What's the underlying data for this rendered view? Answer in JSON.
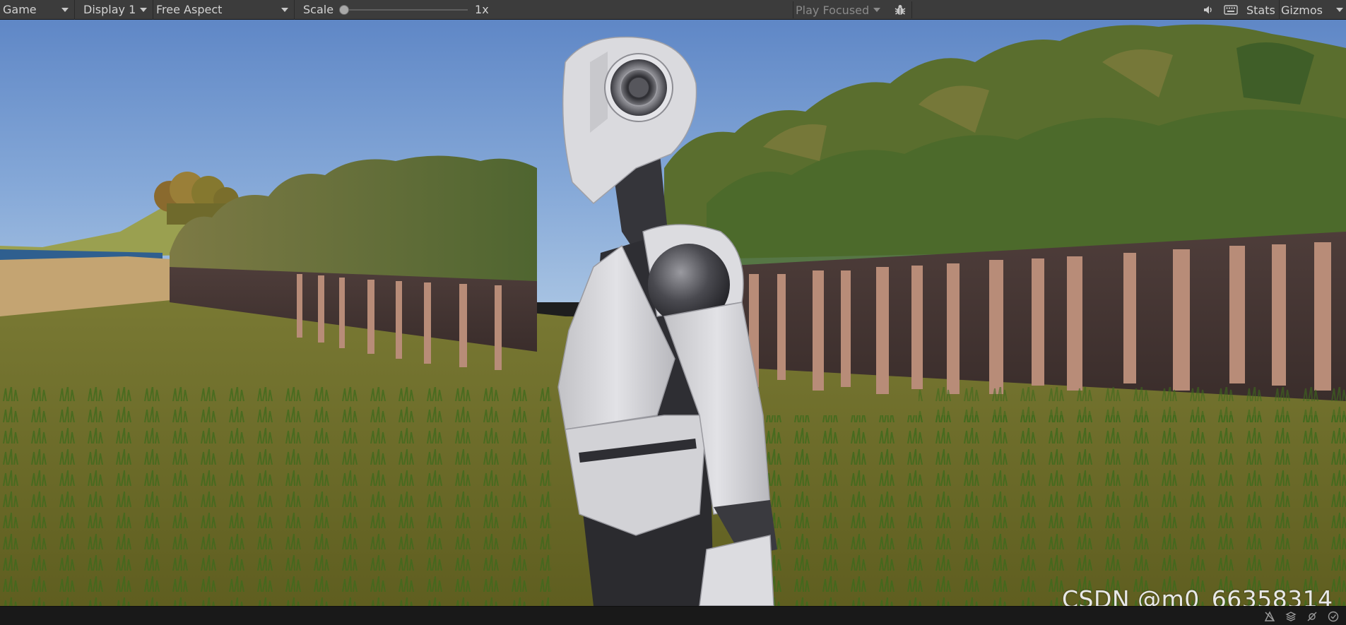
{
  "toolbar": {
    "view_label": "Game",
    "display_label": "Display 1",
    "aspect_label": "Free Aspect",
    "scale_label": "Scale",
    "scale_value": "1x",
    "scale_fraction": 0,
    "play_mode_label": "Play Focused",
    "stats_label": "Stats",
    "gizmos_label": "Gizmos"
  },
  "icons": {
    "debug": "bug-icon",
    "mute": "speaker-icon",
    "shortcuts": "keyboard-icon"
  },
  "statusbar": {
    "icons": [
      "render-pipeline-icon",
      "layers-icon",
      "lighting-icon",
      "checkmark-icon"
    ]
  },
  "watermark": "CSDN @m0_66358314",
  "colors": {
    "toolbar_bg": "#3c3c3c",
    "statusbar_bg": "#191919",
    "sky_top": "#6b93cf",
    "grass": "#6b6a26",
    "robot_white": "#d8d8dc"
  }
}
